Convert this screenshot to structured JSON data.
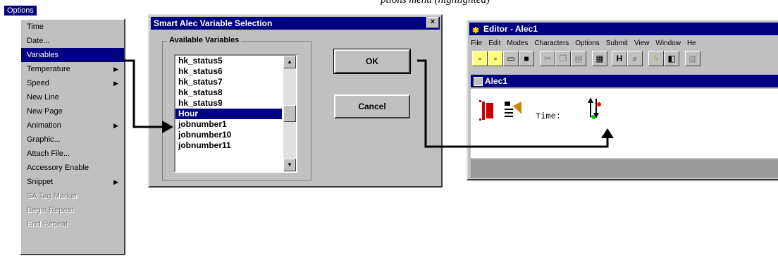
{
  "caption": "ptions menu (highlighted)",
  "options_menu": {
    "title": "Options",
    "items": [
      {
        "label": "Time",
        "state": "normal",
        "submenu": false
      },
      {
        "label": "Date...",
        "state": "normal",
        "submenu": false
      },
      {
        "label": "Variables",
        "state": "selected",
        "submenu": false
      },
      {
        "label": "Temperature",
        "state": "normal",
        "submenu": true
      },
      {
        "label": "Speed",
        "state": "normal",
        "submenu": true
      },
      {
        "label": "New Line",
        "state": "normal",
        "submenu": false
      },
      {
        "label": "New Page",
        "state": "normal",
        "submenu": false
      },
      {
        "label": "Animation",
        "state": "normal",
        "submenu": true
      },
      {
        "label": "Graphic...",
        "state": "normal",
        "submenu": false
      },
      {
        "label": "Attach File...",
        "state": "normal",
        "submenu": false
      },
      {
        "label": "Accessory Enable",
        "state": "normal",
        "submenu": false
      },
      {
        "label": "Snippet",
        "state": "normal",
        "submenu": true
      },
      {
        "label": "SA Tag Marker",
        "state": "disabled",
        "submenu": false
      },
      {
        "label": "Begin Repeat",
        "state": "disabled",
        "submenu": false
      },
      {
        "label": "End Repeat",
        "state": "disabled",
        "submenu": false
      }
    ]
  },
  "dialog": {
    "title": "Smart Alec Variable Selection",
    "close_glyph": "×",
    "group_label": "Available Variables",
    "list_items": [
      "hk_status5",
      "hk_status6",
      "hk_status7",
      "hk_status8",
      "hk_status9",
      "Hour",
      "jobnumber1",
      "jobnumber10",
      "jobnumber11"
    ],
    "selected_item": "Hour",
    "ok_label": "OK",
    "cancel_label": "Cancel"
  },
  "editor": {
    "title": "Editor - Alec1",
    "menus": [
      "File",
      "Edit",
      "Modes",
      "Characters",
      "Options",
      "Submit",
      "View",
      "Window",
      "He"
    ],
    "child_title": "Alec1",
    "content_text": "Time:",
    "toolbar_icons": [
      "new-file-icon",
      "new-doc-icon",
      "open-folder-icon",
      "save-icon",
      "cut-icon",
      "copy-icon",
      "paste-icon",
      "print-icon",
      "bold-h-icon",
      "preview-icon",
      "lightning-icon",
      "layout-icon",
      "extra-icon"
    ]
  },
  "colors": {
    "titlebar": "#000080",
    "face": "#c0c0c0",
    "connector": "#000000"
  }
}
